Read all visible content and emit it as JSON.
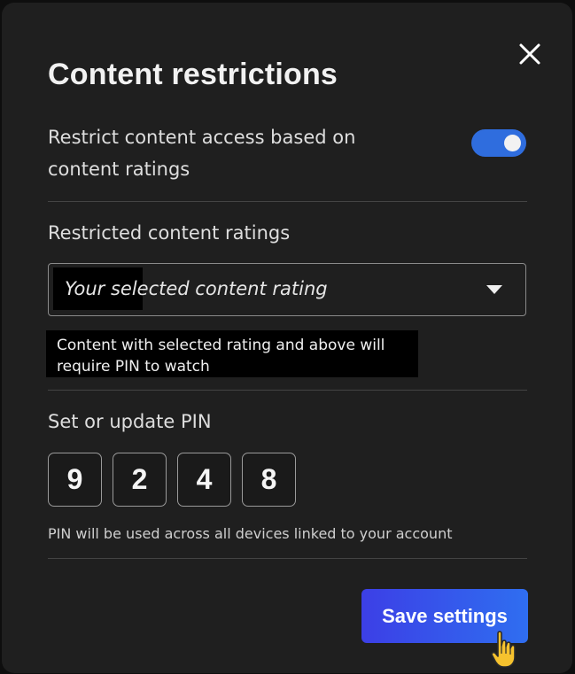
{
  "dialog": {
    "title": "Content restrictions",
    "close_icon": "close-icon"
  },
  "restriction_toggle": {
    "label": "Restrict content access based on content ratings",
    "enabled": true,
    "color": "#2f6dde"
  },
  "ratings": {
    "section_label": "Restricted content ratings",
    "select_value": "Your selected content rating",
    "helper_text": "Content with selected rating and above will require PIN to watch"
  },
  "pin": {
    "section_label": "Set or update PIN",
    "digits": [
      "9",
      "2",
      "4",
      "8"
    ],
    "note": "PIN will be used across all devices linked to your account"
  },
  "footer": {
    "save_label": "Save settings"
  },
  "colors": {
    "background": "#1f1f1f",
    "accent": "#2f6ef0"
  }
}
